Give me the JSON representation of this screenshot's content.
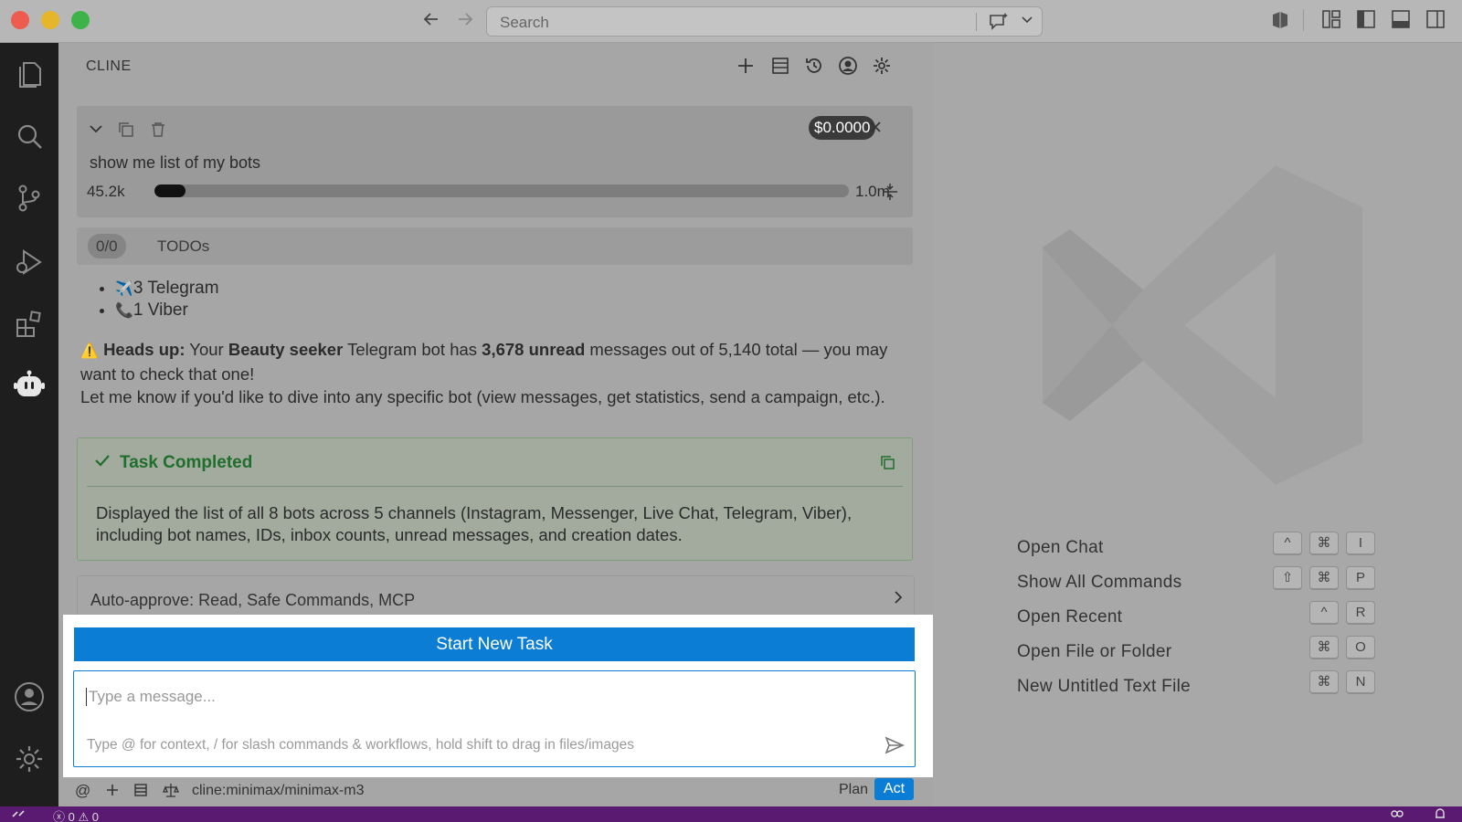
{
  "titlebar": {
    "search_placeholder": "Search"
  },
  "panel": {
    "title": "CLINE",
    "task": {
      "cost": "$0.0000",
      "text": "show me list of my bots",
      "tokens_used": "45.2k",
      "tokens_max": "1.0m",
      "progress_percent": 4.5
    },
    "todos": {
      "count": "0/0",
      "label": "TODOs"
    },
    "bullets": [
      {
        "icon": "✈️",
        "text": "3 Telegram"
      },
      {
        "icon": "📞",
        "text": "1 Viber"
      }
    ],
    "message": {
      "warning_icon": "⚠️",
      "heads_up": "Heads up:",
      "part1": " Your ",
      "bot_name": "Beauty seeker",
      "part2": " Telegram bot has ",
      "unread": "3,678 unread",
      "part3": " messages out of 5,140 total — you may want to check that one!",
      "followup": "Let me know if you'd like to dive into any specific bot (view messages, get statistics, send a campaign, etc.)."
    },
    "completed": {
      "title": "Task Completed",
      "body": "Displayed the list of all 8 bots across 5 channels (Instagram, Messenger, Live Chat, Telegram, Viber), including bot names, IDs, inbox counts, unread messages, and creation dates."
    },
    "auto_approve": {
      "label": "Auto-approve:",
      "value": " Read, Safe Commands, MCP"
    },
    "compose": {
      "start_button": "Start New Task",
      "placeholder": "Type a message...",
      "hint": "Type @ for context, / for slash commands & workflows, hold shift to drag in files/images"
    },
    "bottom": {
      "model": "cline:minimax/minimax-m3",
      "plan": "Plan",
      "act": "Act"
    }
  },
  "editor": {
    "shortcuts": [
      {
        "label": "Open Chat",
        "keys": [
          "^",
          "⌘",
          "I"
        ]
      },
      {
        "label": "Show All Commands",
        "keys": [
          "⇧",
          "⌘",
          "P"
        ]
      },
      {
        "label": "Open Recent",
        "keys": [
          "^",
          "R"
        ]
      },
      {
        "label": "Open File or Folder",
        "keys": [
          "⌘",
          "O"
        ]
      },
      {
        "label": "New Untitled Text File",
        "keys": [
          "⌘",
          "N"
        ]
      }
    ]
  },
  "statusbar": {
    "errors": "0",
    "warnings": "0"
  },
  "colors": {
    "accent": "#0b7dd4",
    "success": "#1f6e2c",
    "statusbar": "#5a1a72",
    "activitybar": "#1e1e1e"
  }
}
